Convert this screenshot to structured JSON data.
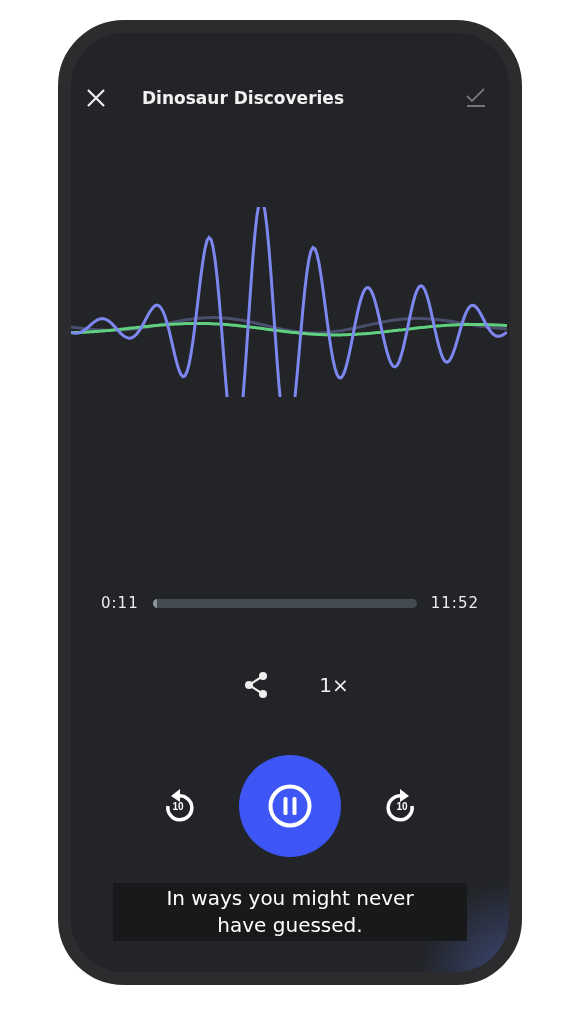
{
  "header": {
    "title": "Dinosaur Discoveries"
  },
  "progress": {
    "elapsed": "0:11",
    "total": "11:52",
    "level": 0.015
  },
  "speed": "1×",
  "controls": {
    "rewind_label": "10",
    "forward_label": "10",
    "playing": true
  },
  "caption": "In ways you might never have guessed."
}
